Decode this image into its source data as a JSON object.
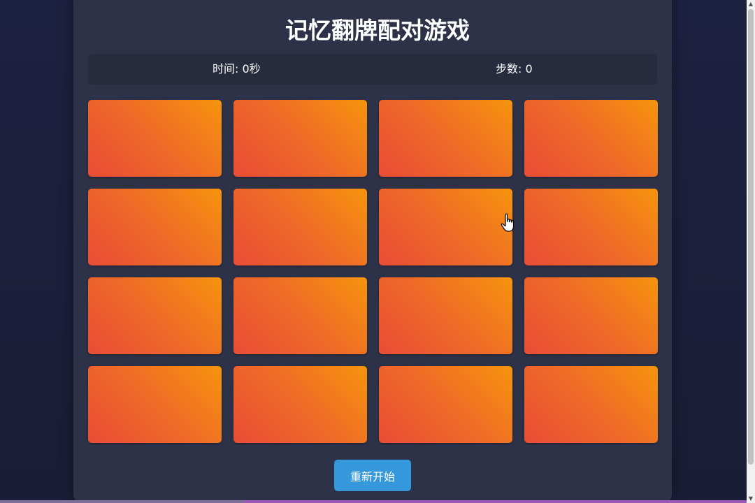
{
  "game": {
    "title": "记忆翻牌配对游戏",
    "stats": {
      "time_label": "时间: 0秒",
      "moves_label": "步数: 0"
    },
    "board": {
      "rows": 4,
      "columns": 4,
      "card_count": 16,
      "card_state": "face-down",
      "card_back_gradient": [
        "#e94c35",
        "#f6940c"
      ]
    },
    "restart_label": "重新开始"
  },
  "colors": {
    "page_background": "#1c2038",
    "panel": "#2d3248",
    "stats_bar": "#262b3d",
    "accent_button": "#3498db",
    "text": "#ffffff"
  },
  "cursor": {
    "type": "pointer-hand-icon"
  }
}
